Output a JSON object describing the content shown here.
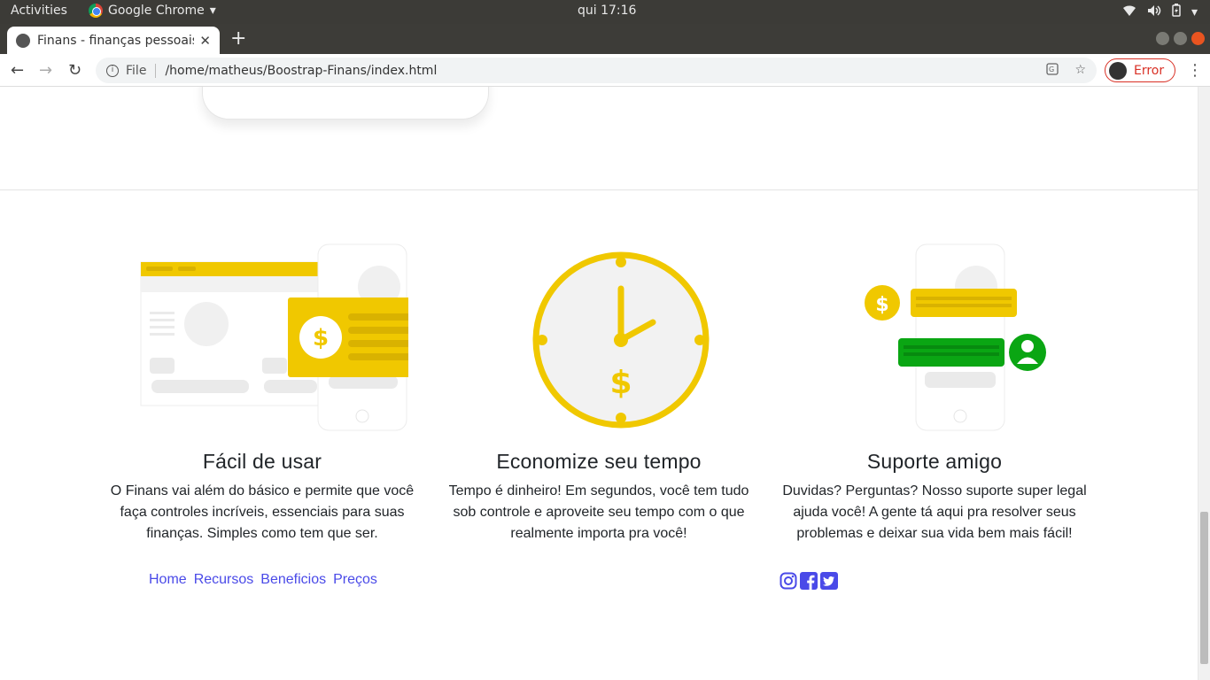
{
  "topbar": {
    "activities": "Activities",
    "app_name": "Google Chrome",
    "clock": "qui 17:16"
  },
  "browser": {
    "tab_title": "Finans - finanças pessoais",
    "omnibox_scheme": "File",
    "url": "/home/matheus/Boostrap-Finans/index.html",
    "profile_status": "Error"
  },
  "features": [
    {
      "title": "Fácil de usar",
      "text": "O Finans vai além do básico e permite que você faça controles incríveis, essenciais para suas finanças. Simples como tem que ser."
    },
    {
      "title": "Economize seu tempo",
      "text": "Tempo é dinheiro! Em segundos, você tem tudo sob controle e aproveite seu tempo com o que realmente importa pra você!"
    },
    {
      "title": "Suporte amigo",
      "text": "Duvidas? Perguntas? Nosso suporte super legal ajuda você! A gente tá aqui pra resolver seus problemas e deixar sua vida bem mais fácil!"
    }
  ],
  "footer": {
    "links": [
      "Home",
      "Recursos",
      "Beneficios",
      "Preços"
    ],
    "social": [
      "instagram-icon",
      "facebook-icon",
      "twitter-icon"
    ]
  },
  "colors": {
    "accent_yellow": "#f0c800",
    "accent_green": "#0aa613",
    "link_blue": "#4a4ae8"
  }
}
